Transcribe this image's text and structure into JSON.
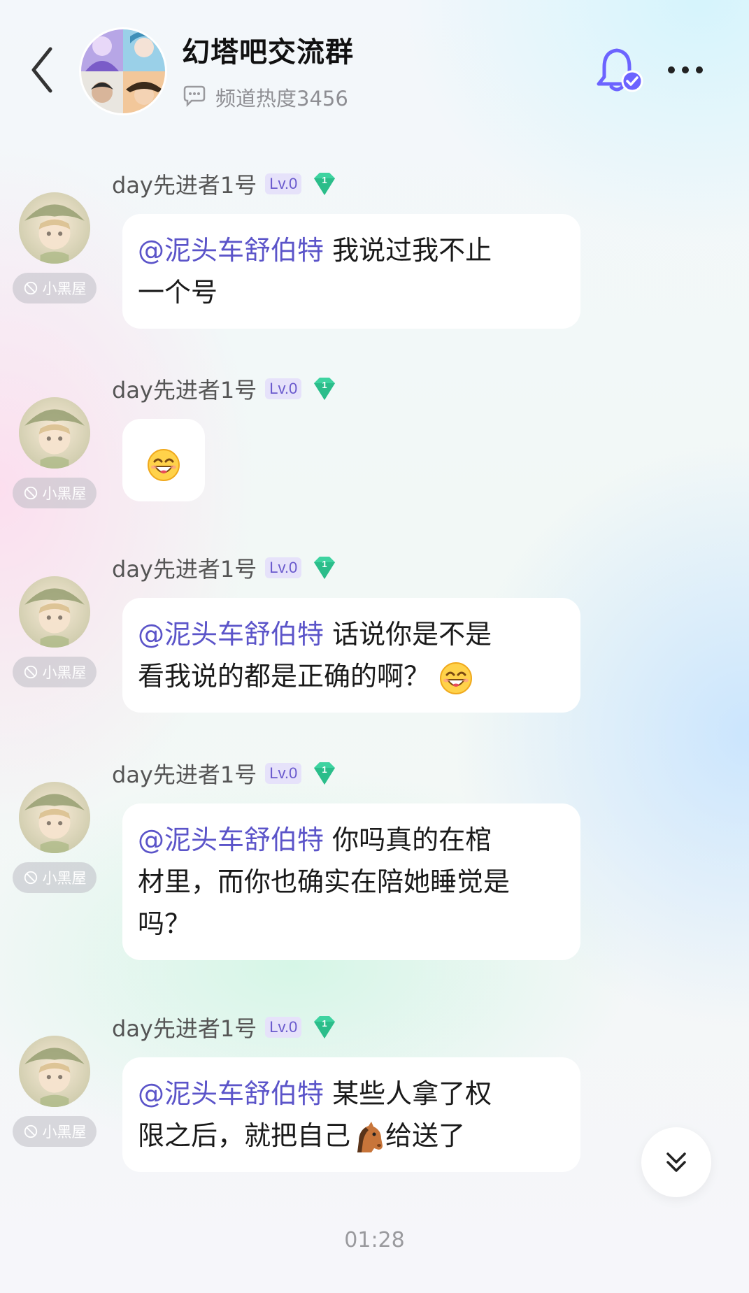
{
  "header": {
    "title": "幻塔吧交流群",
    "heat_label": "频道热度3456"
  },
  "messages": [
    {
      "nickname": "day先进者1号",
      "level": "Lv.0",
      "badge_number": "1",
      "jail_label": "小黑屋",
      "mention": "@泥头车舒伯特",
      "text_line1": " 我说过我不止",
      "text_line2": "一个号"
    },
    {
      "nickname": "day先进者1号",
      "level": "Lv.0",
      "badge_number": "1",
      "jail_label": "小黑屋",
      "emoji": "grin-emoji"
    },
    {
      "nickname": "day先进者1号",
      "level": "Lv.0",
      "badge_number": "1",
      "jail_label": "小黑屋",
      "mention": "@泥头车舒伯特",
      "text_line1": " 话说你是不是",
      "text_line2": "看我说的都是正确的啊？"
    },
    {
      "nickname": "day先进者1号",
      "level": "Lv.0",
      "badge_number": "1",
      "jail_label": "小黑屋",
      "mention": "@泥头车舒伯特",
      "text_line1": " 你吗真的在棺",
      "text_line2": "材里，而你也确实在陪她睡觉是",
      "text_line3": "吗？"
    },
    {
      "nickname": "day先进者1号",
      "level": "Lv.0",
      "badge_number": "1",
      "jail_label": "小黑屋",
      "mention": "@泥头车舒伯特",
      "text_line1": " 某些人拿了权",
      "text_line2a": "限之后，就把自己",
      "text_line2b": "给送了"
    }
  ],
  "timestamp": "01:28",
  "icons": {
    "back": "chevron-left-icon",
    "heat": "chat-bubbles-icon",
    "bell": "bell-check-icon",
    "more": "more-dots-icon",
    "scroll": "double-chevron-down-icon",
    "horse": "horse-emoji"
  },
  "colors": {
    "accent": "#5b54c9",
    "bell": "#6c63ff",
    "gem": "#3ed3a0"
  }
}
